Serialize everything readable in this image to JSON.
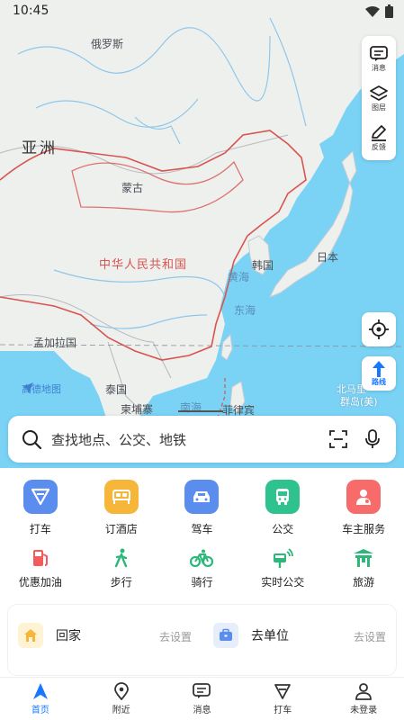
{
  "status_bar": {
    "time": "10:45"
  },
  "map": {
    "labels": {
      "russia": "俄罗斯",
      "asia": "亚洲",
      "mongolia": "蒙古",
      "china": "中华人民共和国",
      "yellow_sea": "黄海",
      "korea": "韩国",
      "japan": "日本",
      "east_sea": "东海",
      "bangladesh": "孟加拉国",
      "thailand": "泰国",
      "cambodia": "柬埔寨",
      "south_sea": "南海",
      "philippines": "菲律宾",
      "mariana_1": "北马里",
      "mariana_2": "群岛(美)"
    },
    "logo_text": "高德地图"
  },
  "tools": {
    "messages": "消息",
    "layers": "图层",
    "feedback": "反馈",
    "route": "路线"
  },
  "search": {
    "placeholder": "查找地点、公交、地铁"
  },
  "services_main": [
    {
      "label": "打车",
      "color": "#5b8def",
      "icon": "taxi-icon"
    },
    {
      "label": "订酒店",
      "color": "#f5b63a",
      "icon": "hotel-bed-icon"
    },
    {
      "label": "驾车",
      "color": "#5b8def",
      "icon": "car-icon"
    },
    {
      "label": "公交",
      "color": "#2ec28e",
      "icon": "bus-icon"
    },
    {
      "label": "车主服务",
      "color": "#f86b6b",
      "icon": "car-owner-icon"
    }
  ],
  "services_sub": [
    {
      "label": "优惠加油",
      "icon": "fuel-pump-icon"
    },
    {
      "label": "步行",
      "icon": "walk-icon"
    },
    {
      "label": "骑行",
      "icon": "bike-icon"
    },
    {
      "label": "实时公交",
      "icon": "realtime-bus-icon"
    },
    {
      "label": "旅游",
      "icon": "travel-gate-icon"
    }
  ],
  "shortcuts": {
    "home_label": "回家",
    "home_action": "去设置",
    "work_label": "去单位",
    "work_action": "去设置"
  },
  "tabs": [
    {
      "label": "首页",
      "active": true
    },
    {
      "label": "附近",
      "active": false
    },
    {
      "label": "消息",
      "active": false
    },
    {
      "label": "打车",
      "active": false
    },
    {
      "label": "未登录",
      "active": false
    }
  ],
  "colors": {
    "accent": "#1677ff",
    "sea": "#7ad3f5",
    "land": "#eef0ee",
    "border_red": "#d9534f"
  }
}
